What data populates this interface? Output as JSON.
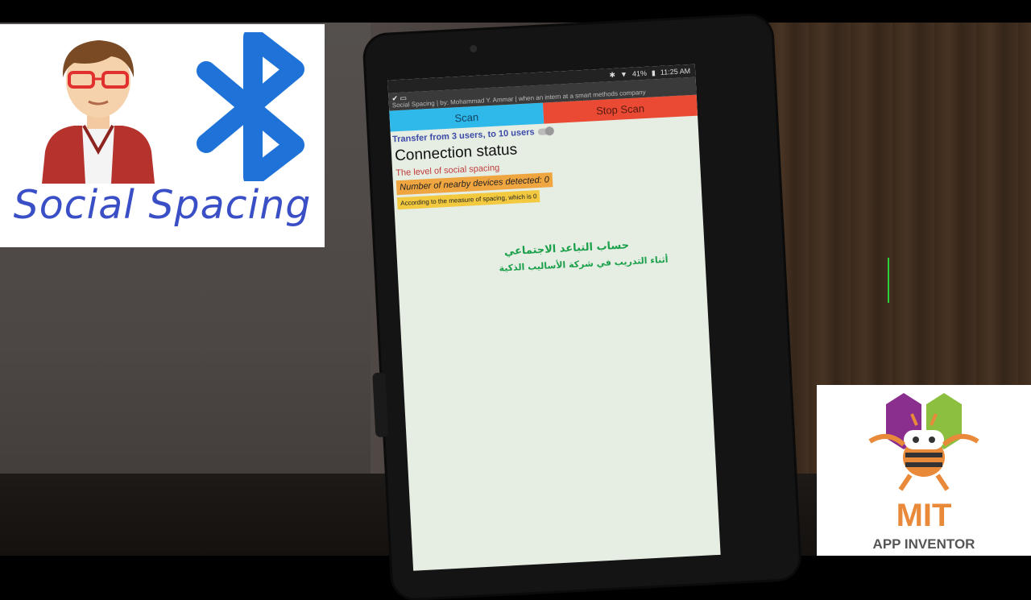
{
  "overlay": {
    "social_title": "Social Spacing",
    "mit_label": "MIT",
    "app_inventor_label": "APP INVENTOR"
  },
  "status_bar": {
    "battery": "41%",
    "time": "11:25 AM"
  },
  "app": {
    "title": "Social Spacing | by: Mohammad Y. Ammar | when an intern at a smart methods company",
    "scan_label": "Scan",
    "stop_scan_label": "Stop Scan",
    "transfer_label": "Transfer from 3 users, to 10 users",
    "connection_status": "Connection status",
    "level_label": "The level of social spacing",
    "nearby_label": "Number of nearby devices detected: 0",
    "measure_label": "According to the measure of spacing, which is 0",
    "arabic_line1": "حساب التباعد الاجتماعي",
    "arabic_line2": "أثناء التدريب في شركة الأساليب الذكية"
  },
  "colors": {
    "scan": "#2fb8ea",
    "stop": "#ea4a33",
    "social_title": "#3a4fc6",
    "bluetooth": "#1f73d8",
    "arabic_text": "#1aa04a",
    "mit_orange": "#e98a3a"
  },
  "icons": [
    "avatar-icon",
    "bluetooth-icon",
    "mit-app-inventor-logo",
    "wifi-icon",
    "bluetooth-status-icon",
    "check-icon"
  ]
}
